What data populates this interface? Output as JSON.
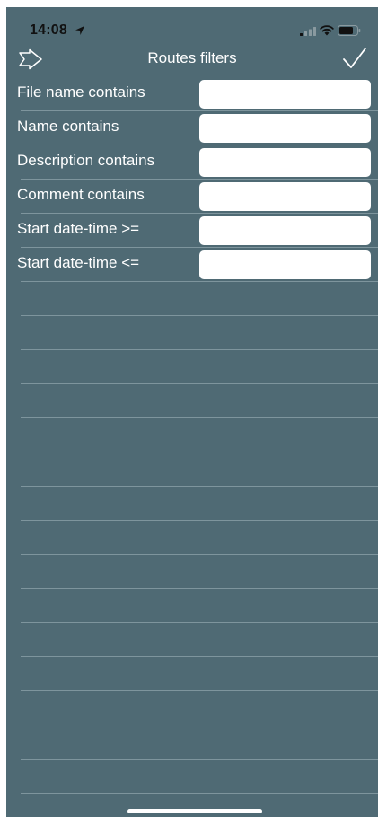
{
  "status_bar": {
    "time": "14:08",
    "icons": [
      "location-arrow-icon",
      "cellular-signal-icon",
      "wifi-icon",
      "battery-icon"
    ]
  },
  "nav": {
    "title": "Routes filters",
    "back_icon": "back-arrow-icon",
    "done_icon": "checkmark-icon"
  },
  "filters": [
    {
      "label": "File name contains",
      "value": "",
      "placeholder": ""
    },
    {
      "label": "Name contains",
      "value": "",
      "placeholder": ""
    },
    {
      "label": "Description contains",
      "value": "",
      "placeholder": ""
    },
    {
      "label": "Comment contains",
      "value": "",
      "placeholder": ""
    },
    {
      "label": "Start date-time >=",
      "value": "",
      "placeholder": ""
    },
    {
      "label": "Start date-time <=",
      "value": "",
      "placeholder": ""
    }
  ],
  "colors": {
    "background": "#4f6a74",
    "separator": "#7e959d",
    "text": "#ffffff",
    "input_background": "#ffffff"
  }
}
